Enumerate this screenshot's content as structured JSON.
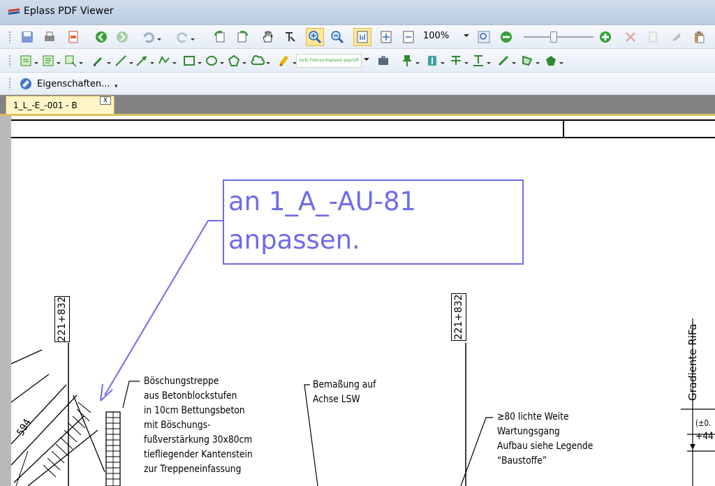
{
  "window": {
    "title": "Eplass PDF Viewer"
  },
  "toolbar": {
    "zoom_level": "100%",
    "stamp_preview": "Gelb Freiraumsplane geprüft"
  },
  "properties_toolbar": {
    "label": "Eigenschaften..."
  },
  "tabs": [
    {
      "label": "1_L_-E_-001 - B",
      "close": "X"
    }
  ],
  "document": {
    "comment": {
      "line1": "an 1_A_-AU-81",
      "line2": "anpassen."
    },
    "station_labels": [
      "221+832",
      "221+832"
    ],
    "note_boschung": [
      "Böschungstreppe",
      "aus Betonblockstufen",
      "in 10cm Bettungsbeton",
      "mit Böschungs-",
      "fußverstärkung 30x80cm",
      "tiefliegender Kantenstein",
      "zur Treppeneinfassung"
    ],
    "note_bemassung": [
      "Bemaßung auf",
      "Achse LSW"
    ],
    "note_wartung": [
      "≥80 lichte Weite",
      "Wartungsgang",
      "Aufbau siehe Legende",
      "“Baustoffe”"
    ],
    "gradient_label": "Gradiente RiFa",
    "edge_text_1": "(±0.",
    "edge_text_2": "+44",
    "slope_label": "594"
  },
  "colors": {
    "annotation": "#6f6bea",
    "tab": "#fff5c7",
    "tabstrip": "#838383"
  }
}
